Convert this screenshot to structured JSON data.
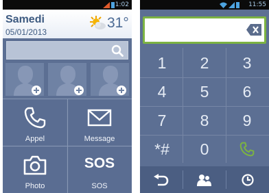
{
  "left_screen": {
    "status": {
      "time": "1:02"
    },
    "header": {
      "day": "Samedi",
      "date": "05/01/2013",
      "temperature": "31°",
      "weather_icon": "sun-cloud-icon"
    },
    "search": {
      "icon": "search-icon"
    },
    "favorites": [
      {
        "icon": "add-contact-icon"
      },
      {
        "icon": "add-contact-icon"
      },
      {
        "icon": "add-contact-icon"
      }
    ],
    "tiles": [
      {
        "label": "Appel",
        "icon": "phone-icon"
      },
      {
        "label": "Message",
        "icon": "envelope-icon"
      },
      {
        "label": "Photo",
        "icon": "camera-icon"
      },
      {
        "label": "SOS",
        "text": "SOS"
      }
    ]
  },
  "right_screen": {
    "status": {
      "time": "11:55"
    },
    "number_field": {
      "value": "",
      "icon": "backspace-icon"
    },
    "keys": [
      "1",
      "2",
      "3",
      "4",
      "5",
      "6",
      "7",
      "8",
      "9",
      "*#",
      "0"
    ],
    "call_key_icon": "call-icon",
    "bottom_bar": [
      {
        "icon": "back-icon"
      },
      {
        "icon": "contacts-icon"
      },
      {
        "icon": "history-icon"
      }
    ]
  },
  "colors": {
    "accent_green": "#7cb342",
    "tile_bg": "#5c6f93",
    "header_text": "#3d5a80"
  }
}
